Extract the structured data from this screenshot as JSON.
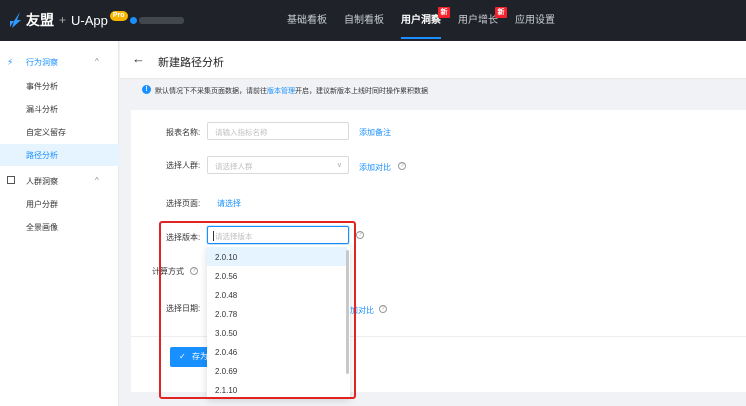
{
  "topbar": {
    "brand": "友盟",
    "separator": "+",
    "app_name": "U-App",
    "pro_badge": "Pro",
    "nav": [
      {
        "label": "基础看板",
        "badge": ""
      },
      {
        "label": "自制看板",
        "badge": ""
      },
      {
        "label": "用户洞察",
        "badge": "新",
        "active": true
      },
      {
        "label": "用户增长",
        "badge": "新"
      },
      {
        "label": "应用设置",
        "badge": ""
      }
    ]
  },
  "sidebar": {
    "group1": {
      "label": "行为洞察",
      "chevron": "^"
    },
    "group1_items": [
      "事件分析",
      "漏斗分析",
      "自定义留存",
      "路径分析"
    ],
    "active_item": "路径分析",
    "group2": {
      "label": "人群洞察",
      "chevron": "^"
    },
    "group2_items": [
      "用户分群",
      "全景画像"
    ]
  },
  "header": {
    "back": "←",
    "title": "新建路径分析"
  },
  "notice": {
    "icon": "!",
    "text_before": "默认情况下不采集页面数据，请前往",
    "link": "版本管理",
    "text_after": "开启，建议新版本上线时同时操作累积数据"
  },
  "form": {
    "report_name_label": "报表名称:",
    "report_name_placeholder": "请输入指标名称",
    "add_note": "添加备注",
    "crowd_label": "选择人群:",
    "crowd_placeholder": "请选择人群",
    "add_compare": "添加对比",
    "page_label": "选择页面:",
    "page_link": "请选择",
    "version_label": "选择版本:",
    "version_placeholder": "请选择版本",
    "calc_label": "计算方式",
    "date_label": "选择日期:",
    "date_add_compare_partial": "加对比",
    "save_button": "存为"
  },
  "dropdown": {
    "options": [
      "2.0.10",
      "2.0.56",
      "2.0.48",
      "2.0.78",
      "3.0.50",
      "2.0.46",
      "2.0.69",
      "2.1.10"
    ],
    "highlighted": "2.0.10"
  },
  "colors": {
    "primary": "#1890ff",
    "topbar": "#1f2329",
    "badge": "#f5222d",
    "annotation": "#e02424"
  }
}
